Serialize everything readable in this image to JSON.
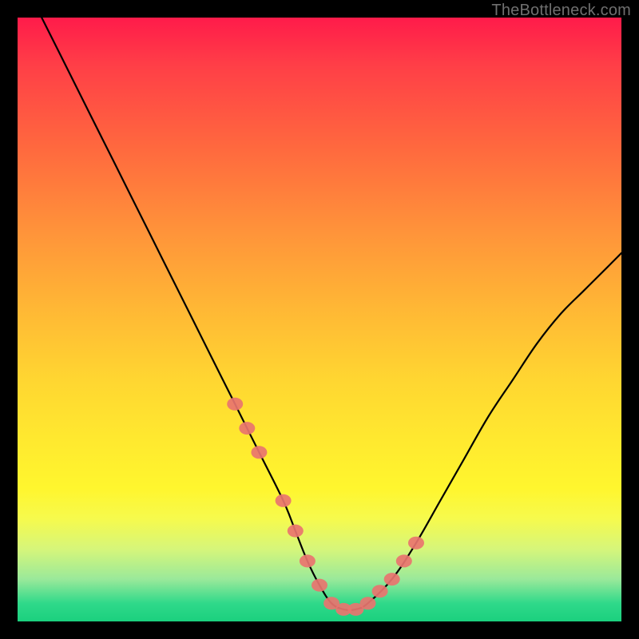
{
  "watermark": "TheBottleneck.com",
  "chart_data": {
    "type": "line",
    "title": "",
    "xlabel": "",
    "ylabel": "",
    "xlim": [
      0,
      100
    ],
    "ylim": [
      0,
      100
    ],
    "series": [
      {
        "name": "bottleneck-curve",
        "x": [
          4,
          8,
          12,
          16,
          20,
          24,
          28,
          32,
          36,
          40,
          44,
          46,
          48,
          50,
          52,
          54,
          56,
          58,
          62,
          66,
          70,
          74,
          78,
          82,
          86,
          90,
          94,
          98,
          100
        ],
        "values": [
          100,
          92,
          84,
          76,
          68,
          60,
          52,
          44,
          36,
          28,
          20,
          15,
          10,
          6,
          3,
          2,
          2,
          3,
          7,
          13,
          20,
          27,
          34,
          40,
          46,
          51,
          55,
          59,
          61
        ]
      }
    ],
    "markers": {
      "name": "highlight-points",
      "x": [
        36,
        38,
        40,
        44,
        46,
        48,
        50,
        52,
        54,
        56,
        58,
        60,
        62,
        64,
        66
      ],
      "values": [
        36,
        32,
        28,
        20,
        15,
        10,
        6,
        3,
        2,
        2,
        3,
        5,
        7,
        10,
        13
      ]
    }
  }
}
